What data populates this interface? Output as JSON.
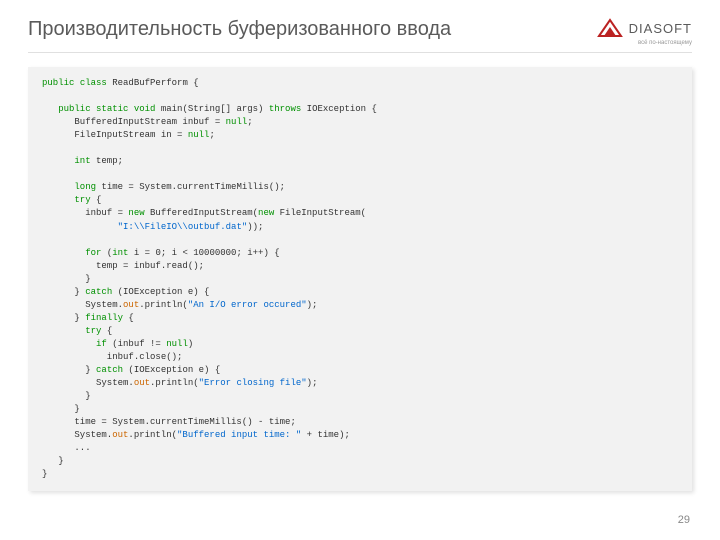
{
  "header": {
    "title": "Производительность буферизованного ввода",
    "logo_text": "DIASOFT",
    "logo_tagline": "всё по-настоящему"
  },
  "page_number": "29",
  "code": {
    "t01a": "public",
    "t01b": "class",
    "t01c": " ReadBufPerform {",
    "t02a": "public",
    "t02b": "static",
    "t02c": "void",
    "t02d": " main(String[] args) ",
    "t02e": "throws",
    "t02f": " IOException {",
    "t03": "      BufferedInputStream inbuf = ",
    "t03a": "null",
    "t03b": ";",
    "t04": "      FileInputStream in = ",
    "t04a": "null",
    "t04b": ";",
    "t05a": "int",
    "t05b": " temp;",
    "t06a": "long",
    "t06b": " time = System.currentTimeMillis();",
    "t07a": "try",
    "t07b": " {",
    "t08a": "        inbuf = ",
    "t08b": "new",
    "t08c": " BufferedInputStream(",
    "t08d": "new",
    "t08e": " FileInputStream(",
    "t09a": "\"I:\\\\FileIO\\\\outbuf.dat\"",
    "t09b": "));",
    "t10a": "for",
    "t10b": " (",
    "t10c": "int",
    "t10d": " i = 0; i < 10000000; i++) {",
    "t11": "          temp = inbuf.read();",
    "t12": "        }",
    "t13a": "      } ",
    "t13b": "catch",
    "t13c": " (IOException e) {",
    "t14a": "        System.",
    "t14b": "out",
    "t14c": ".println(",
    "t14d": "\"An I/O error occured\"",
    "t14e": ");",
    "t15a": "      } ",
    "t15b": "finally",
    "t15c": " {",
    "t16a": "try",
    "t16b": " {",
    "t17a": "if",
    "t17b": " (inbuf != ",
    "t17c": "null",
    "t17d": ")",
    "t18": "            inbuf.close();",
    "t19a": "        } ",
    "t19b": "catch",
    "t19c": " (IOException e) {",
    "t20a": "          System.",
    "t20b": "out",
    "t20c": ".println(",
    "t20d": "\"Error closing file\"",
    "t20e": ");",
    "t21": "        }",
    "t22": "      }",
    "t23": "      time = System.currentTimeMillis() - time;",
    "t24a": "      System.",
    "t24b": "out",
    "t24c": ".println(",
    "t24d": "\"Buffered input time: \"",
    "t24e": " + time);",
    "t25": "      ...",
    "t26": "   }",
    "t27": "}"
  }
}
